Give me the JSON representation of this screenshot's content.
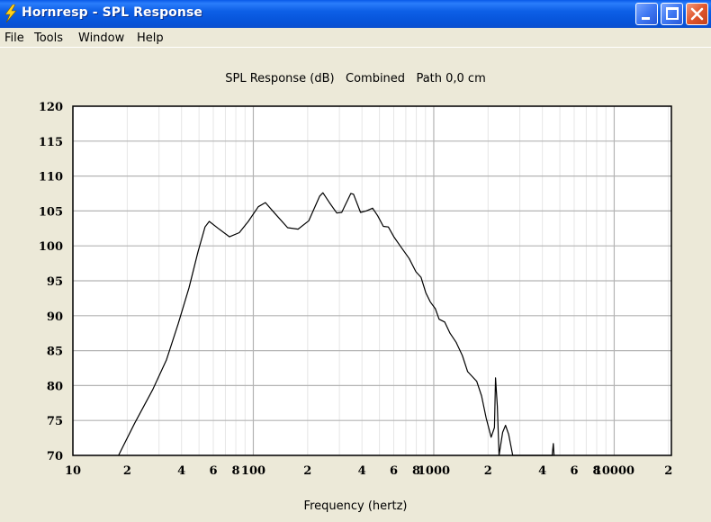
{
  "window": {
    "title": "Hornresp - SPL Response",
    "icon": "lightning-bolt-icon",
    "controls": {
      "minimize": "minimize-icon",
      "maximize": "maximize-icon",
      "close": "close-icon"
    }
  },
  "menu": {
    "items": [
      {
        "label": "File"
      },
      {
        "label": "Tools"
      },
      {
        "label": "Window"
      },
      {
        "label": "Help"
      }
    ]
  },
  "colors": {
    "titlebar": "#0653d9",
    "background": "#ece9d8",
    "plot_background": "#ffffff",
    "major_grid": "#b4b4b4",
    "minor_grid": "#e6e6e6",
    "curve": "#000000"
  },
  "chart_data": {
    "type": "line",
    "title": "SPL Response (dB)   Combined   Path 0,0 cm",
    "xlabel": "Frequency (hertz)",
    "ylabel": "",
    "xscale": "log",
    "xlim": [
      10,
      20750
    ],
    "ylim": [
      70,
      120
    ],
    "grid": true,
    "legend": "none",
    "y_ticks": [
      70,
      75,
      80,
      85,
      90,
      95,
      100,
      105,
      110,
      115,
      120
    ],
    "y_tick_labels": [
      "70",
      "75",
      "80",
      "85",
      "90",
      "95",
      "100",
      "105",
      "110",
      "115",
      "120"
    ],
    "x_ticks": [
      10,
      20,
      40,
      60,
      80,
      100,
      200,
      400,
      600,
      800,
      1000,
      2000,
      4000,
      6000,
      8000,
      10000,
      20000
    ],
    "x_tick_labels": [
      "10",
      "2",
      "4",
      "6",
      "8",
      "100",
      "2",
      "4",
      "6",
      "8",
      "1000",
      "2",
      "4",
      "6",
      "8",
      "10000",
      "2"
    ],
    "series": [
      {
        "name": "SPL Combined",
        "x": [
          17.9,
          22,
          27.8,
          33,
          38.3,
          44,
          49.3,
          54,
          57,
          63.9,
          73.8,
          83.6,
          93.8,
          106.5,
          116.7,
          131,
          155,
          177,
          203,
          233,
          243,
          264,
          290,
          309,
          347,
          359,
          393,
          422,
          458,
          489,
          525,
          560,
          601,
          660,
          730,
          796,
          850,
          903,
          955,
          1020,
          1070,
          1150,
          1230,
          1330,
          1440,
          1540,
          1660,
          1730,
          1840,
          1950,
          2080,
          2170,
          2200,
          2250,
          2300,
          2410,
          2500,
          2600,
          2740,
          4530,
          4600,
          4640
        ],
        "y": [
          70,
          74.6,
          79.5,
          83.7,
          88.8,
          94,
          99.1,
          102.7,
          103.5,
          102.5,
          101.3,
          101.9,
          103.5,
          105.6,
          106.2,
          104.7,
          102.6,
          102.4,
          103.6,
          107.1,
          107.6,
          106.2,
          104.7,
          104.8,
          107.5,
          107.4,
          104.8,
          105,
          105.4,
          104.3,
          102.8,
          102.7,
          101.3,
          99.8,
          98.2,
          96.3,
          95.5,
          93.3,
          92,
          91,
          89.5,
          89.1,
          87.5,
          86.2,
          84.3,
          82,
          81.1,
          80.6,
          78.5,
          75.4,
          72.6,
          74,
          81.1,
          77,
          70,
          73.3,
          74.3,
          73,
          70,
          70,
          71.7,
          70
        ]
      }
    ]
  }
}
